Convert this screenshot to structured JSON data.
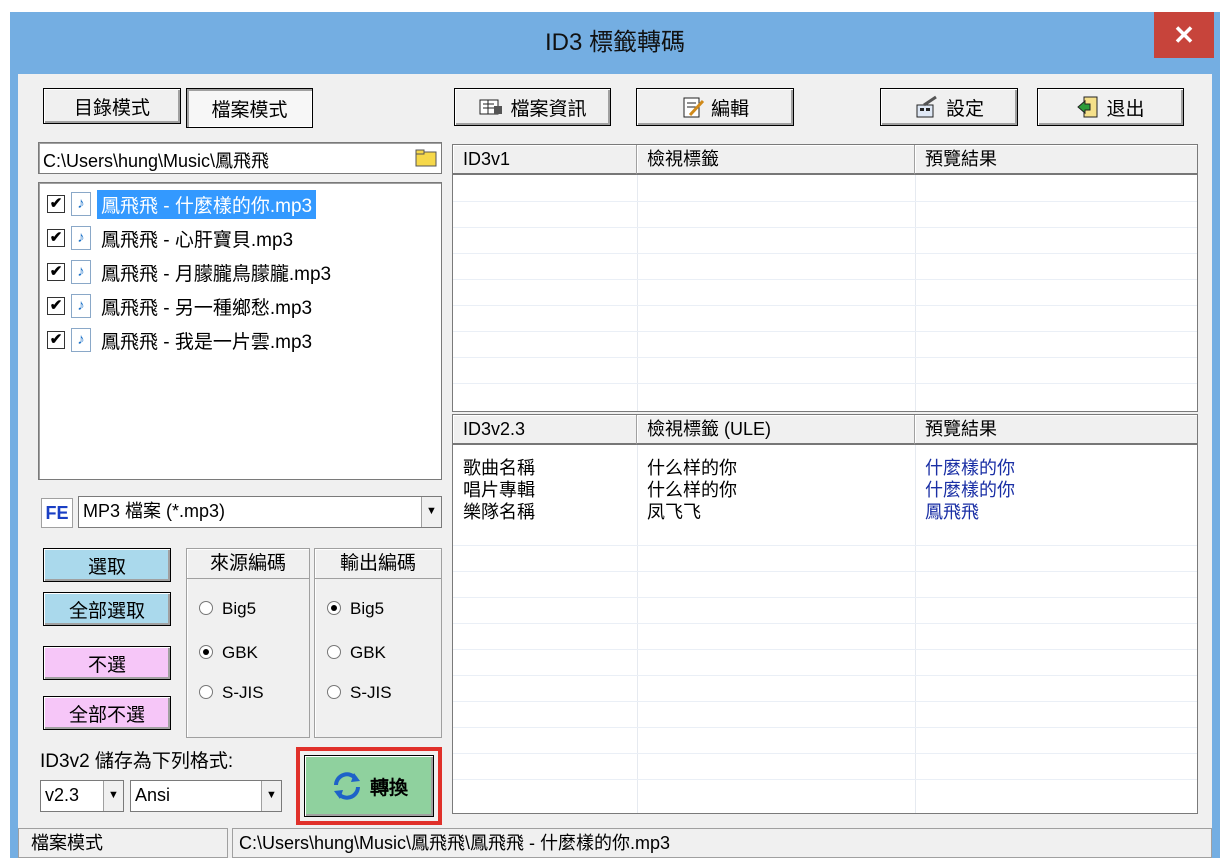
{
  "window": {
    "title": "ID3 標籤轉碼",
    "close_glyph": "✕"
  },
  "mode_tabs": {
    "dir_mode": "目錄模式",
    "file_mode": "檔案模式"
  },
  "toolbar": {
    "info": "檔案資訊",
    "edit": "編輯",
    "settings": "設定",
    "exit": "退出"
  },
  "path_input": {
    "value": "C:\\Users\\hung\\Music\\鳳飛飛"
  },
  "files": [
    {
      "name": "鳳飛飛 - 什麼樣的你.mp3",
      "checked": "✔",
      "selected": true
    },
    {
      "name": "鳳飛飛 - 心肝寶貝.mp3",
      "checked": "✔"
    },
    {
      "name": "鳳飛飛 - 月朦朧鳥朦朧.mp3",
      "checked": "✔"
    },
    {
      "name": "鳳飛飛 - 另一種鄉愁.mp3",
      "checked": "✔"
    },
    {
      "name": "鳳飛飛 - 我是一片雲.mp3",
      "checked": "✔"
    }
  ],
  "filter": {
    "fe_label": "FE",
    "value": "MP3 檔案 (*.mp3)"
  },
  "selection": {
    "select": "選取",
    "select_all": "全部選取",
    "deselect": "不選",
    "deselect_all": "全部不選"
  },
  "source_encoding": {
    "title": "來源編碼",
    "options": [
      "Big5",
      "GBK",
      "S-JIS"
    ],
    "selected": "GBK"
  },
  "output_encoding": {
    "title": "輸出編碼",
    "options": [
      "Big5",
      "GBK",
      "S-JIS"
    ],
    "selected": "Big5"
  },
  "save_format": {
    "label": "ID3v2 儲存為下列格式:",
    "version": "v2.3",
    "charset": "Ansi"
  },
  "convert_button": {
    "label": "轉換"
  },
  "id3v1_table": {
    "headers": [
      "ID3v1",
      "檢視標籤",
      "預覽結果"
    ],
    "rows": []
  },
  "id3v2_table": {
    "headers": [
      "ID3v2.3",
      "檢視標籤 (ULE)",
      "預覽結果"
    ],
    "rows": [
      [
        "歌曲名稱",
        "什么样的你",
        "什麼樣的你"
      ],
      [
        "唱片專輯",
        "什么样的你",
        "什麼樣的你"
      ],
      [
        "樂隊名稱",
        "凤飞飞",
        "鳳飛飛"
      ]
    ]
  },
  "status": {
    "mode": "檔案模式",
    "path": "C:\\Users\\hung\\Music\\鳳飛飛\\鳳飛飛 - 什麼樣的你.mp3"
  },
  "colors": {
    "titlebar": "#74aee2",
    "close": "#c7443b",
    "selection": "#3399ff",
    "select_btn": "#aad9ec",
    "deselect_btn": "#f6c6f8",
    "convert_btn": "#8fd19e",
    "highlight_box": "#e0302a",
    "preview_text": "#1a2fa5"
  }
}
